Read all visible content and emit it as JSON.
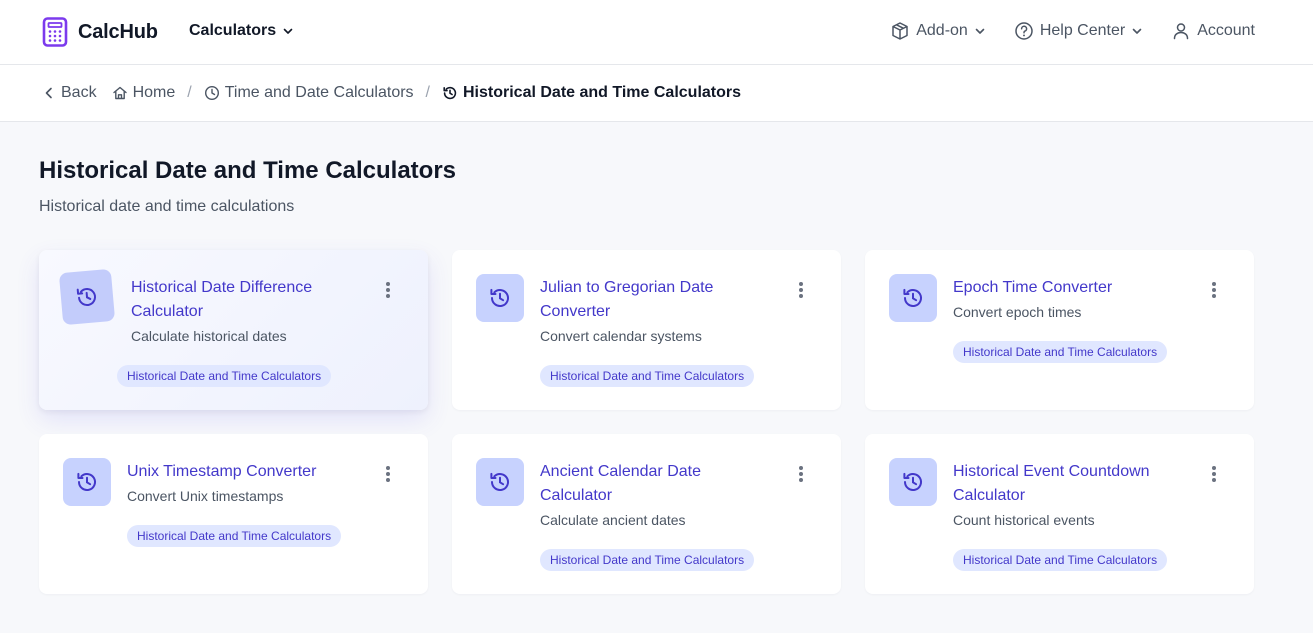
{
  "app": {
    "name": "CalcHub"
  },
  "nav": {
    "calculators": "Calculators",
    "addon": "Add-on",
    "help": "Help Center",
    "account": "Account"
  },
  "breadcrumb": {
    "back": "Back",
    "home": "Home",
    "parent": "Time and Date Calculators",
    "current": "Historical Date and Time Calculators"
  },
  "page": {
    "title": "Historical Date and Time Calculators",
    "subtitle": "Historical date and time calculations"
  },
  "cards": [
    {
      "title": "Historical Date Difference Calculator",
      "description": "Calculate historical dates",
      "tag": "Historical Date and Time Calculators",
      "icon": "history-icon"
    },
    {
      "title": "Julian to Gregorian Date Converter",
      "description": "Convert calendar systems",
      "tag": "Historical Date and Time Calculators",
      "icon": "history-icon"
    },
    {
      "title": "Epoch Time Converter",
      "description": "Convert epoch times",
      "tag": "Historical Date and Time Calculators",
      "icon": "history-icon"
    },
    {
      "title": "Unix Timestamp Converter",
      "description": "Convert Unix timestamps",
      "tag": "Historical Date and Time Calculators",
      "icon": "history-icon"
    },
    {
      "title": "Ancient Calendar Date Calculator",
      "description": "Calculate ancient dates",
      "tag": "Historical Date and Time Calculators",
      "icon": "history-icon"
    },
    {
      "title": "Historical Event Countdown Calculator",
      "description": "Count historical events",
      "tag": "Historical Date and Time Calculators",
      "icon": "history-icon"
    }
  ],
  "colors": {
    "accent": "#4338ca",
    "logo": "#7c3aed",
    "icon_bg": "#c7d2fe",
    "tag_bg": "#e0e7ff",
    "page_bg": "#f7f8fb"
  }
}
